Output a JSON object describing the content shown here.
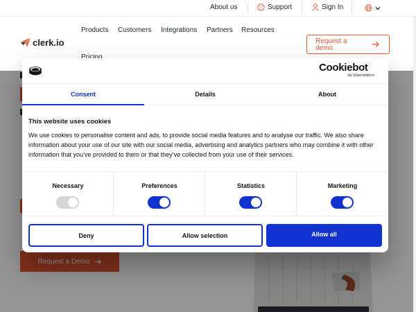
{
  "topbar": {
    "about_label": "About us",
    "support_label": "Support",
    "signin_label": "Sign In"
  },
  "nav": {
    "logo_text": "clerk.io",
    "items": [
      "Products",
      "Customers",
      "Integrations",
      "Partners",
      "Resources",
      "Pricing"
    ],
    "demo_label": "Request a demo"
  },
  "page": {
    "cta_label": "Request a Demo"
  },
  "cookie": {
    "brand": "Cookiebot",
    "brand_sub": "by Usercentrics",
    "tabs": [
      "Consent",
      "Details",
      "About"
    ],
    "title": "This website uses cookies",
    "text": "We use cookies to personalise content and ads, to provide social media features and to analyse our traffic. We also share information about your use of our site with our social media, advertising and analytics partners who may combine it with other information that you’ve provided to them or that they’ve collected from your use of their services.",
    "categories": [
      {
        "label": "Necessary",
        "on": true,
        "disabled": true
      },
      {
        "label": "Preferences",
        "on": true,
        "disabled": false
      },
      {
        "label": "Statistics",
        "on": true,
        "disabled": false
      },
      {
        "label": "Marketing",
        "on": true,
        "disabled": false
      }
    ],
    "buttons": {
      "deny": "Deny",
      "allow_selection": "Allow selection",
      "allow_all": "Allow all"
    }
  },
  "colors": {
    "accent": "#1032cf",
    "brand": "#e2542d"
  }
}
